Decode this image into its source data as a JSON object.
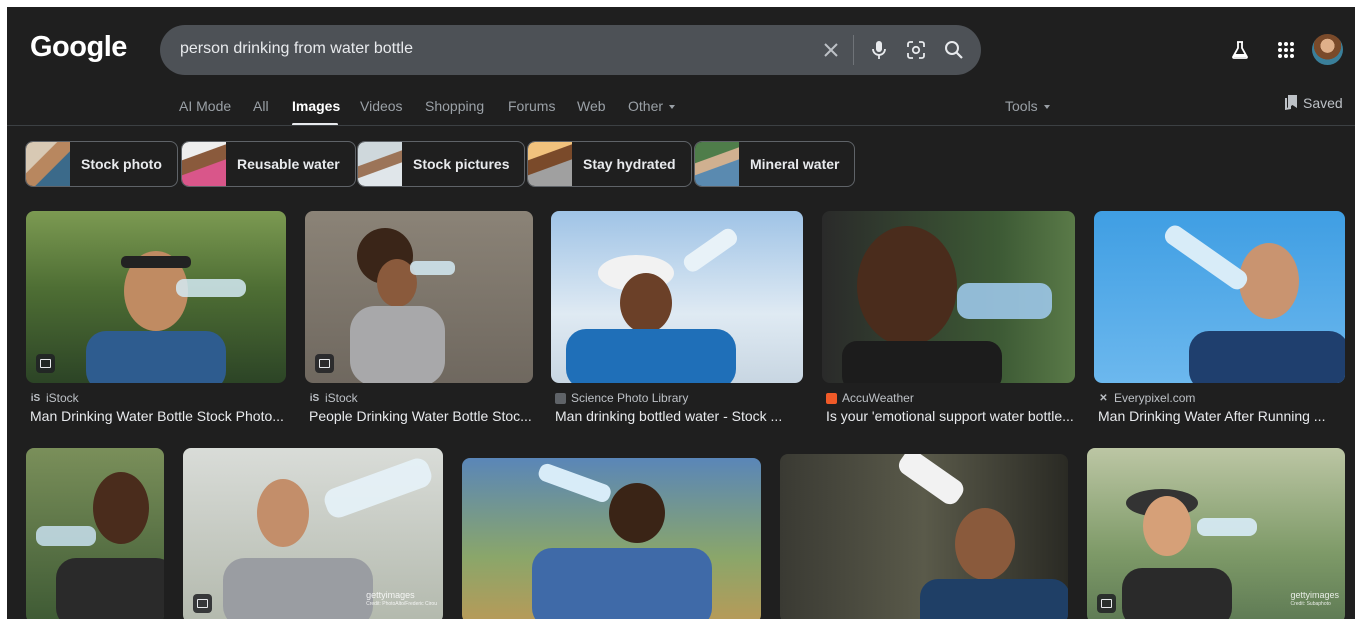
{
  "header": {
    "logo": "Google",
    "search_value": "person drinking from water bottle",
    "icons": [
      "clear-icon",
      "microphone-icon",
      "lens-icon",
      "search-icon",
      "labs-flask-icon",
      "apps-grid-icon"
    ]
  },
  "nav": {
    "tabs": [
      "AI Mode",
      "All",
      "Images",
      "Videos",
      "Shopping",
      "Forums",
      "Web",
      "Other"
    ],
    "active": "Images",
    "tools": "Tools",
    "saved": "Saved"
  },
  "chips": [
    "Stock photo",
    "Reusable water",
    "Stock pictures",
    "Stay hydrated",
    "Mineral water"
  ],
  "results_row1": [
    {
      "source": "iStock",
      "title": "Man Drinking Water Bottle Stock Photo..."
    },
    {
      "source": "iStock",
      "title": "People Drinking Water Bottle Stoc..."
    },
    {
      "source": "Science Photo Library",
      "title": "Man drinking bottled water - Stock ..."
    },
    {
      "source": "AccuWeather",
      "title": "Is your 'emotional support water bottle..."
    },
    {
      "source": "Everypixel.com",
      "title": "Man Drinking Water After Running ..."
    }
  ],
  "watermarks": [
    "gettyimages",
    "Credit: PhotoAlto/Frederic Cirou",
    "gettyimages",
    "Credit: Subaphoto"
  ],
  "colors": {
    "background": "#1f1f1f",
    "search_bar": "#4d5156",
    "text_primary": "#e8eaed",
    "text_secondary": "#9aa0a6"
  }
}
